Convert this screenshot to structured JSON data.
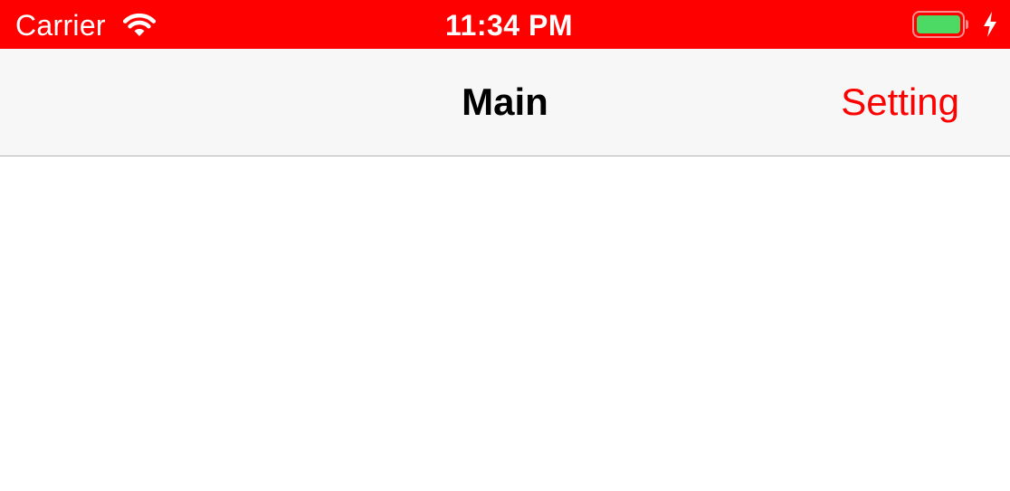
{
  "status_bar": {
    "carrier": "Carrier",
    "time": "11:34 PM",
    "wifi_icon": "wifi-icon",
    "battery_icon": "battery-icon",
    "charging_icon": "charging-bolt-icon",
    "background_color": "#fe0000",
    "battery_fill_color": "#4cd964"
  },
  "nav_bar": {
    "title": "Main",
    "right_button_label": "Setting",
    "tint_color": "#fe0000",
    "background_color": "#f7f7f7"
  }
}
